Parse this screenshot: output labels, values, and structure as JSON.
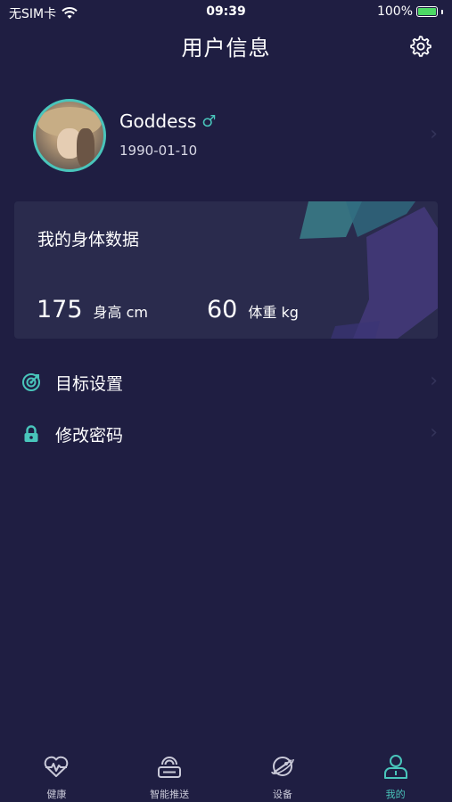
{
  "status_bar": {
    "carrier": "无SIM卡",
    "time": "09:39",
    "battery": "100%"
  },
  "header": {
    "title": "用户信息",
    "settings_icon": "gear-icon"
  },
  "profile": {
    "name": "Goddess",
    "gender_symbol": "♂",
    "birthday": "1990-01-10"
  },
  "body_data": {
    "title": "我的身体数据",
    "height": {
      "value": "175",
      "label": "身高 cm"
    },
    "weight": {
      "value": "60",
      "label": "体重 kg"
    }
  },
  "menu": {
    "items": [
      {
        "label": "目标设置",
        "icon": "target-icon"
      },
      {
        "label": "修改密码",
        "icon": "lock-icon"
      }
    ]
  },
  "tab_bar": {
    "tabs": [
      {
        "label": "健康",
        "icon": "heart-pulse-icon",
        "active": false
      },
      {
        "label": "智能推送",
        "icon": "push-device-icon",
        "active": false
      },
      {
        "label": "设备",
        "icon": "planet-icon",
        "active": false
      },
      {
        "label": "我的",
        "icon": "user-icon",
        "active": true
      }
    ]
  },
  "colors": {
    "background": "#1f1e42",
    "card": "#2a2b4d",
    "accent": "#49c5bb"
  }
}
